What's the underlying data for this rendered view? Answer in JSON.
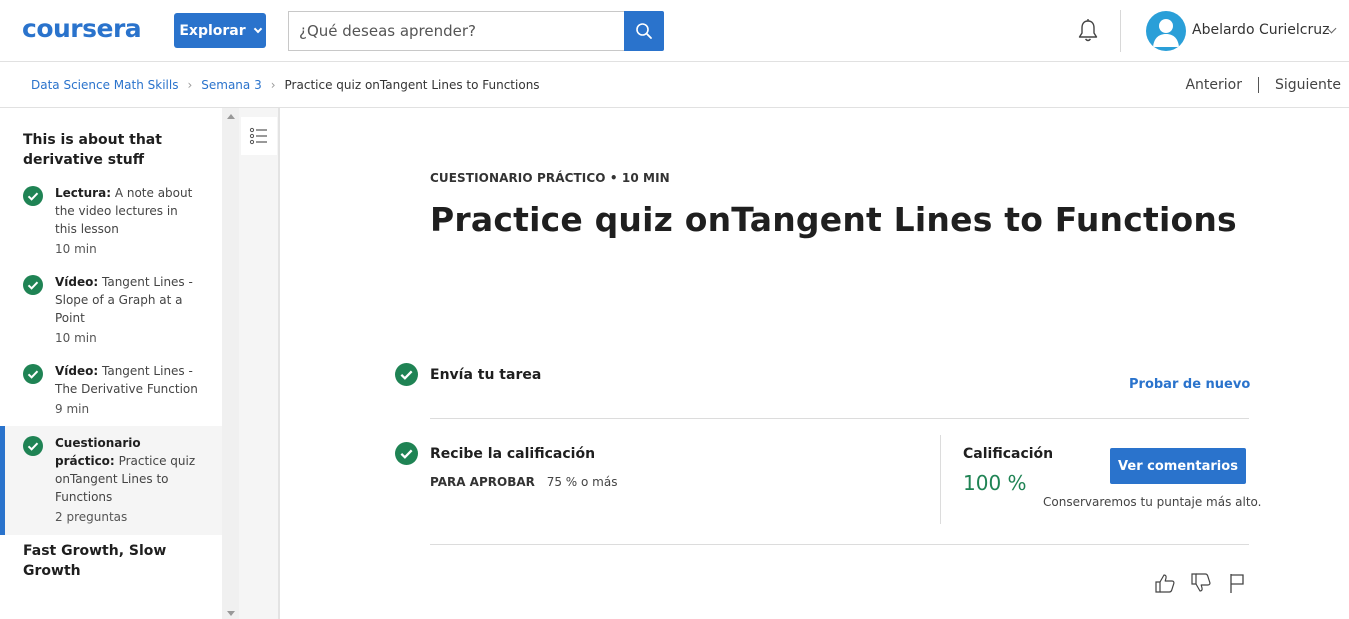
{
  "header": {
    "logo_text": "coursera",
    "explore_label": "Explorar",
    "search_placeholder": "¿Qué deseas aprender?",
    "user_name": "Abelardo Curielcruz",
    "icons": [
      "search-icon",
      "bell-icon",
      "avatar-icon",
      "chevron-down-icon"
    ]
  },
  "breadcrumb": {
    "items": [
      "Data Science Math Skills",
      "Semana 3"
    ],
    "current": "Practice quiz onTangent Lines to Functions",
    "prev_label": "Anterior",
    "next_label": "Siguiente"
  },
  "sidebar": {
    "section1_title": "This is about that derivative stuff",
    "items": [
      {
        "kind": "Lectura:",
        "title": "A note about the video lectures in this lesson",
        "duration": "10 min",
        "status": "completed"
      },
      {
        "kind": "Vídeo:",
        "title": "Tangent Lines - Slope of a Graph at a Point",
        "duration": "10 min",
        "status": "completed"
      },
      {
        "kind": "Vídeo:",
        "title": "Tangent Lines - The Derivative Function",
        "duration": "9 min",
        "status": "completed"
      },
      {
        "kind": "Cuestionario práctico:",
        "title": "Practice quiz onTangent Lines to Functions",
        "duration": "2 preguntas",
        "status": "completed",
        "active": true
      }
    ],
    "section2_title": "Fast Growth, Slow Growth"
  },
  "main": {
    "kicker": "CUESTIONARIO PRÁCTICO • 10 MIN",
    "title": "Practice quiz onTangent Lines to Functions",
    "step1": {
      "label": "Envía tu tarea",
      "action": "Probar de nuevo"
    },
    "step2": {
      "label": "Recibe la calificación",
      "pass_label": "PARA APROBAR",
      "pass_value": "75 % o más",
      "grade_label": "Calificación",
      "grade_value": "100 %",
      "button": "Ver comentarios",
      "note": "Conservaremos tu puntaje más alto."
    },
    "reaction_icons": [
      "thumbs-up-icon",
      "thumbs-down-icon",
      "flag-icon"
    ]
  },
  "colors": {
    "brand_blue": "#2a73cc",
    "success_green": "#1f8354",
    "avatar_bg": "#2a9fd8"
  }
}
